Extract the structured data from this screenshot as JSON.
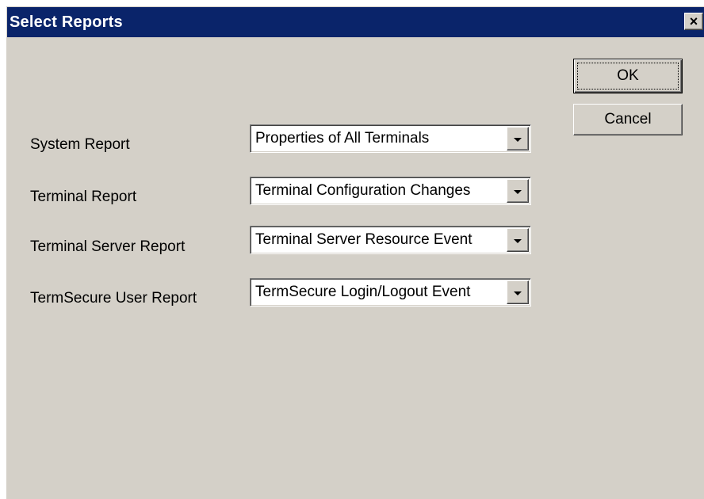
{
  "window": {
    "title": "Select Reports",
    "close_glyph": "×"
  },
  "buttons": {
    "ok_label": "OK",
    "cancel_label": "Cancel"
  },
  "reports": [
    {
      "label": "System Report",
      "value": "Properties of All Terminals"
    },
    {
      "label": "Terminal Report",
      "value": "Terminal Configuration Changes"
    },
    {
      "label": "Terminal Server Report",
      "value": "Terminal Server Resource Event"
    },
    {
      "label": "TermSecure User Report",
      "value": "TermSecure Login/Logout Event"
    }
  ],
  "icons": {
    "close": "close-icon",
    "dropdown": "chevron-down-icon"
  },
  "colors": {
    "titlebar": "#0a246a",
    "face": "#d4d0c8",
    "field": "#ffffff"
  }
}
